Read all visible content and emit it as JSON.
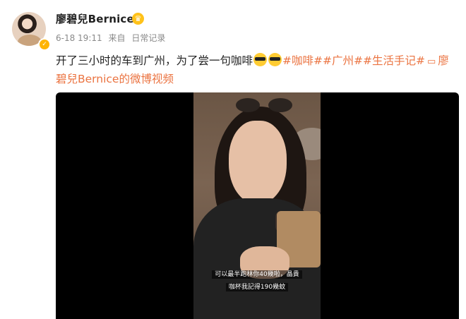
{
  "post": {
    "username": "廖碧兒Bernice",
    "date": "6-18 19:11",
    "source_prefix": "来自",
    "source": "日常记录",
    "text_main": "开了三小时的车到广州，为了尝一句咖啡",
    "tags": [
      "#咖啡#",
      "#广州#",
      "#生活手记#"
    ],
    "video_link_label": "廖碧兒Bernice的微博视频",
    "emoji_name": "cool-sunglasses-emoji",
    "verified_icon": "verified-badge-icon",
    "crown_icon": "member-crown-icon",
    "colors": {
      "tag": "#eb7340",
      "verified": "#ffb400",
      "crown": "#ffc21a"
    }
  },
  "video": {
    "subtitle_line1": "可以最半跑林你40幾啦，晶貴",
    "subtitle_line2": "咖杯我記得190幾蚊"
  }
}
